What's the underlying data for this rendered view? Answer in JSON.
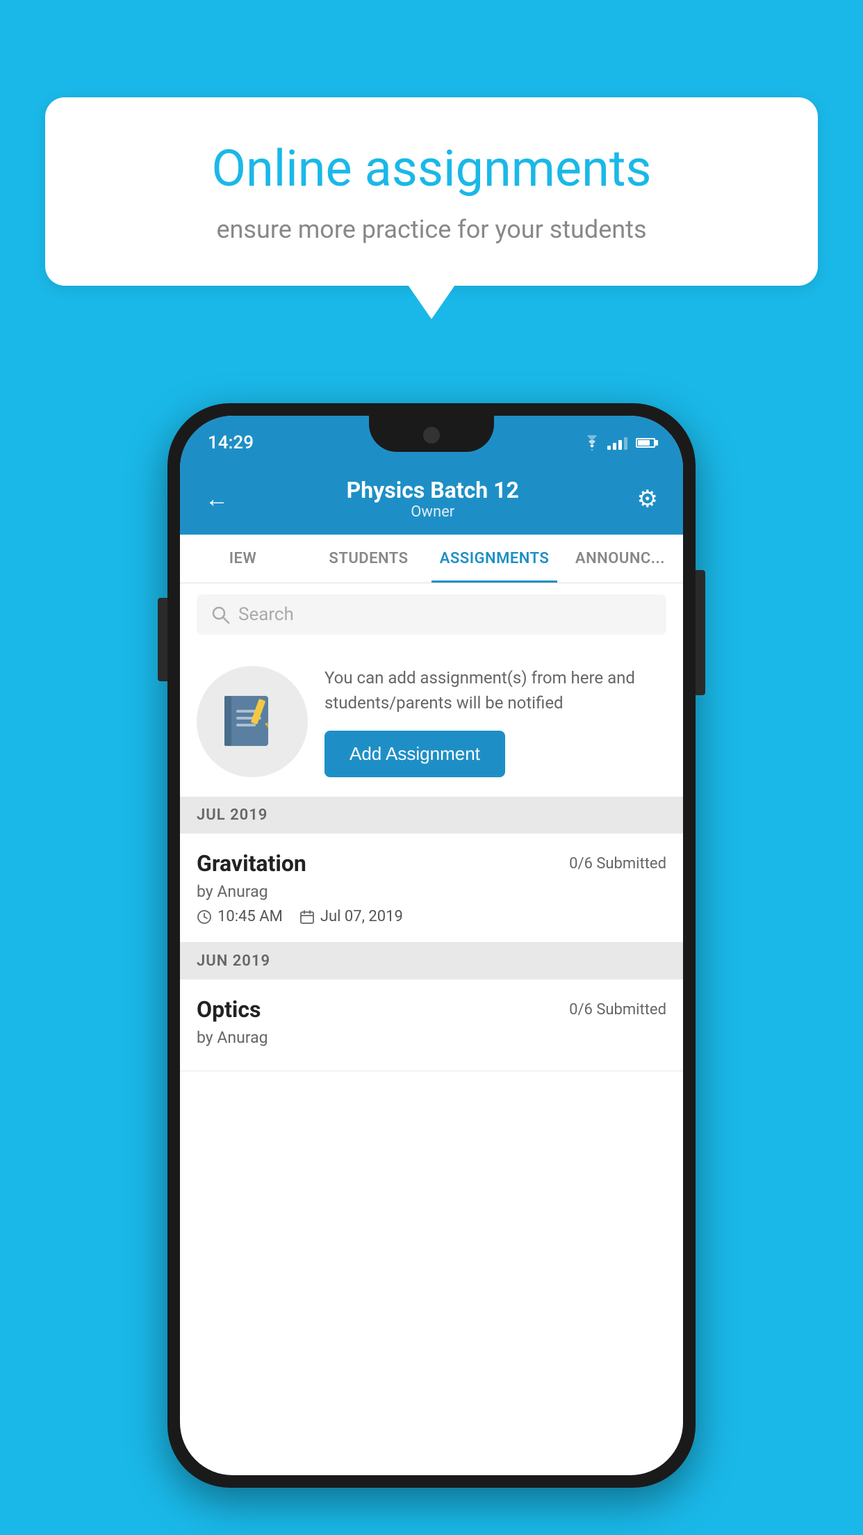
{
  "background_color": "#1ab8e8",
  "speech_bubble": {
    "title": "Online assignments",
    "subtitle": "ensure more practice for your students"
  },
  "status_bar": {
    "time": "14:29"
  },
  "app_header": {
    "title": "Physics Batch 12",
    "subtitle": "Owner",
    "back_label": "←",
    "settings_label": "⚙"
  },
  "tabs": [
    {
      "label": "IEW",
      "active": false
    },
    {
      "label": "STUDENTS",
      "active": false
    },
    {
      "label": "ASSIGNMENTS",
      "active": true
    },
    {
      "label": "ANNOUNCEMENTS",
      "active": false
    }
  ],
  "search": {
    "placeholder": "Search"
  },
  "info_card": {
    "description": "You can add assignment(s) from here and students/parents will be notified",
    "add_button_label": "Add Assignment"
  },
  "sections": [
    {
      "header": "JUL 2019",
      "assignments": [
        {
          "title": "Gravitation",
          "submitted": "0/6 Submitted",
          "by": "by Anurag",
          "time": "10:45 AM",
          "date": "Jul 07, 2019"
        }
      ]
    },
    {
      "header": "JUN 2019",
      "assignments": [
        {
          "title": "Optics",
          "submitted": "0/6 Submitted",
          "by": "by Anurag",
          "time": "",
          "date": ""
        }
      ]
    }
  ]
}
